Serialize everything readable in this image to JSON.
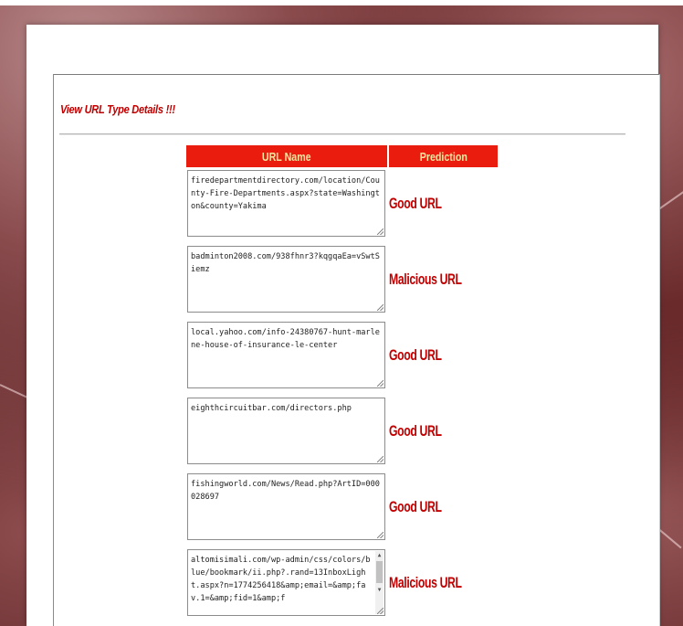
{
  "section": {
    "title": "View URL Type Details !!!"
  },
  "table": {
    "headers": {
      "url": "URL Name",
      "prediction": "Prediction"
    },
    "rows": [
      {
        "url": "firedepartmentdirectory.com/location/County-Fire-Departments.aspx?state=Washington&county=Yakima",
        "prediction": "Good URL"
      },
      {
        "url": "badminton2008.com/938fhnr3?kqgqaEa=vSwtSiemz",
        "prediction": "Malicious URL"
      },
      {
        "url": "local.yahoo.com/info-24380767-hunt-marlene-house-of-insurance-le-center",
        "prediction": "Good URL"
      },
      {
        "url": "eighthcircuitbar.com/directors.php",
        "prediction": "Good URL"
      },
      {
        "url": "fishingworld.com/News/Read.php?ArtID=000028697",
        "prediction": "Good URL"
      },
      {
        "url": "altomisimali.com/wp-admin/css/colors/blue/bookmark/ii.php?.rand=13InboxLight.aspx?n=1774256418&amp;email=&amp;fav.1=&amp;fid=1&amp;f",
        "prediction": "Malicious URL"
      }
    ]
  },
  "colors": {
    "header_bg": "#ea1c0d",
    "header_text": "#f5e6a0",
    "prediction_text": "#c00000"
  }
}
